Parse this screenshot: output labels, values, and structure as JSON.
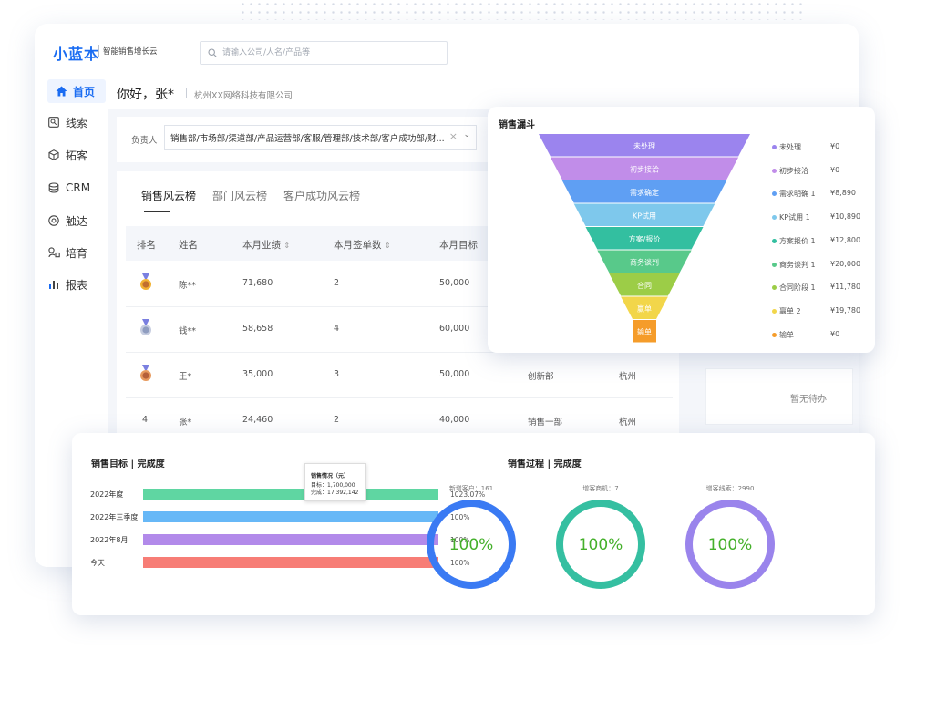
{
  "header": {
    "logo": "小蓝本",
    "tagline": "智能销售增长云",
    "search_placeholder": "请输入公司/人名/产品等"
  },
  "sidebar": {
    "items": [
      {
        "label": "首页",
        "icon": "home-icon",
        "active": true
      },
      {
        "label": "线索",
        "icon": "leads-icon",
        "active": false
      },
      {
        "label": "拓客",
        "icon": "cube-icon",
        "active": false
      },
      {
        "label": "CRM",
        "icon": "database-icon",
        "active": false
      },
      {
        "label": "触达",
        "icon": "target-icon",
        "active": false
      },
      {
        "label": "培育",
        "icon": "nurture-icon",
        "active": false
      },
      {
        "label": "报表",
        "icon": "bar-chart-icon",
        "active": false
      }
    ]
  },
  "greeting": {
    "text": "你好，张*",
    "company": "杭州XX网络科技有限公司"
  },
  "filter": {
    "label": "负责人",
    "value": "销售部/市场部/渠道部/产品运营部/客服/管理部/技术部/客户成功部/财..."
  },
  "ranking": {
    "tabs": [
      "销售风云榜",
      "部门风云榜",
      "客户成功风云榜"
    ],
    "columns": [
      "排名",
      "姓名",
      "本月业绩",
      "本月签单数",
      "本月目标"
    ],
    "sort_icon": "sort-icon",
    "rows": [
      {
        "rank": "1",
        "name": "陈**",
        "sales": "71,680",
        "deals": "2",
        "target": "50,000",
        "dept": "",
        "city": ""
      },
      {
        "rank": "2",
        "name": "钱**",
        "sales": "58,658",
        "deals": "4",
        "target": "60,000",
        "dept": "",
        "city": ""
      },
      {
        "rank": "3",
        "name": "王*",
        "sales": "35,000",
        "deals": "3",
        "target": "50,000",
        "dept": "创新部",
        "city": "杭州"
      },
      {
        "rank": "4",
        "name": "张*",
        "sales": "24,460",
        "deals": "2",
        "target": "40,000",
        "dept": "销售一部",
        "city": "杭州"
      }
    ]
  },
  "todo": {
    "empty_text": "暂无待办"
  },
  "funnel": {
    "title": "销售漏斗",
    "stages": [
      {
        "name": "未处理",
        "legend": "未处理",
        "value": "¥0",
        "color": "#9b84ee"
      },
      {
        "name": "初步接洽",
        "legend": "初步接洽",
        "value": "¥0",
        "color": "#c18de9"
      },
      {
        "name": "需求确定",
        "legend": "需求明确 1",
        "value": "¥8,890",
        "color": "#5f9ff3"
      },
      {
        "name": "KP试用",
        "legend": "KP试用 1",
        "value": "¥10,890",
        "color": "#7ec8ec"
      },
      {
        "name": "方案/报价",
        "legend": "方案报价 1",
        "value": "¥12,800",
        "color": "#33bfa0"
      },
      {
        "name": "商务谈判",
        "legend": "商务谈判 1",
        "value": "¥20,000",
        "color": "#58c98a"
      },
      {
        "name": "合同",
        "legend": "合同阶段 1",
        "value": "¥11,780",
        "color": "#9ccd47"
      },
      {
        "name": "赢单",
        "legend": "赢单 2",
        "value": "¥19,780",
        "color": "#f2d64a"
      },
      {
        "name": "输单",
        "legend": "输单",
        "value": "¥0",
        "color": "#f59c2a"
      }
    ]
  },
  "sales_target": {
    "title": "销售目标 | 完成度",
    "bars": [
      {
        "label": "2022年度",
        "pct": "1023.07%",
        "color": "#5fd6a2"
      },
      {
        "label": "2022年三季度",
        "pct": "100%",
        "color": "#67b8f7"
      },
      {
        "label": "2022年8月",
        "pct": "100%",
        "color": "#b28aea"
      },
      {
        "label": "今天",
        "pct": "100%",
        "color": "#f77d76"
      }
    ],
    "tooltip": {
      "title": "销售情况（元）",
      "target": "目标：1,700,000",
      "done": "完成：17,392,142"
    }
  },
  "sales_process": {
    "title": "销售过程 | 完成度",
    "rings": [
      {
        "label": "新增客户：161",
        "value": "100%",
        "color": "#3a7af3"
      },
      {
        "label": "增客商机：7",
        "value": "100%",
        "color": "#35bfa1"
      },
      {
        "label": "增客线索：2990",
        "value": "100%",
        "color": "#9a84ec"
      }
    ]
  }
}
